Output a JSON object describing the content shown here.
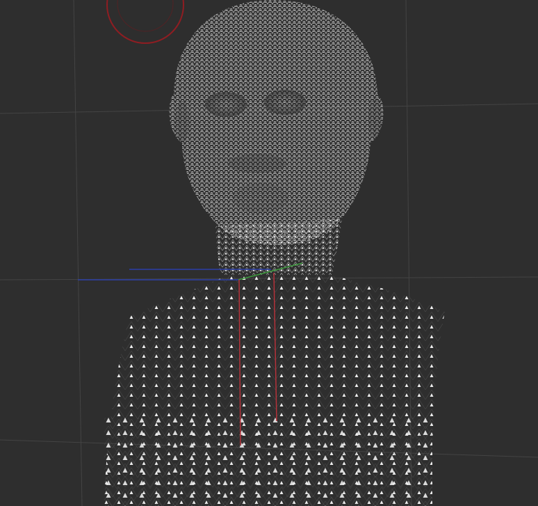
{
  "viewport": {
    "background_color": "#2e2e2e",
    "grid_color": "#444444",
    "mesh_color": "#e6e6e6",
    "mesh_type": "wireframe-triangulated-bust",
    "axis_x_color": "#b5323a",
    "axis_y_color": "#3c9a3c",
    "axis_z_color": "#2b3fa8",
    "gizmo_color": "#8f1d22",
    "view_rotate_handle_icon": "rotate-ring-icon",
    "object_origin_icon": "transform-axes-icon"
  }
}
